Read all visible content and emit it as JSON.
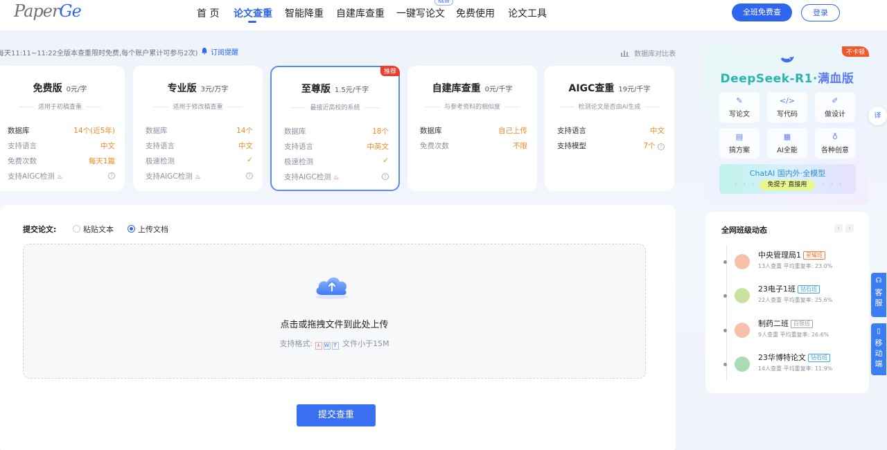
{
  "header": {
    "logo_main": "Paper",
    "logo_accent": "Ge",
    "nav": [
      "首 页",
      "论文查重",
      "智能降重",
      "自建库查重",
      "一键写论文",
      "免费使用",
      "论文工具"
    ],
    "new_badge": "NEW",
    "cta_label": "全班免费查",
    "login_label": "登录",
    "accent_color": "#2f66f0"
  },
  "promo": {
    "text": "每天11:11~11:22全版本查重限时免费,每个账户累计可参与2次)",
    "subscribe_label": "订阅提醒",
    "compare_label": "数据库对比表"
  },
  "plans": [
    {
      "name": "免费版",
      "price": "0元/字",
      "desc": "适用于初稿查重",
      "badge": "",
      "rows": [
        {
          "k": "数据库",
          "v": "14个(近5年)",
          "type": "text"
        },
        {
          "k": "支持语言",
          "v": "中文",
          "type": "text"
        },
        {
          "k": "免费次数",
          "v": "每天1篇",
          "type": "text"
        },
        {
          "k": "支持AIGC检测",
          "v": "",
          "type": "help"
        }
      ]
    },
    {
      "name": "专业版",
      "price": "3元/万字",
      "desc": "适用于修改稿查重",
      "badge": "",
      "rows": [
        {
          "k": "数据库",
          "v": "14个",
          "type": "text"
        },
        {
          "k": "支持语言",
          "v": "中文",
          "type": "text"
        },
        {
          "k": "极速检测",
          "v": "",
          "type": "check"
        },
        {
          "k": "支持AIGC检测",
          "v": "",
          "type": "help"
        }
      ]
    },
    {
      "name": "至尊版",
      "price": "1.5元/千字",
      "desc": "最接近高校的系统",
      "badge": "推荐",
      "rows": [
        {
          "k": "数据库",
          "v": "18个",
          "type": "text"
        },
        {
          "k": "支持语言",
          "v": "中英文",
          "type": "text"
        },
        {
          "k": "极速检测",
          "v": "",
          "type": "check"
        },
        {
          "k": "支持AIGC检测",
          "v": "",
          "type": "help"
        }
      ]
    },
    {
      "name": "自建库查重",
      "price": "0元/千字",
      "desc": "与参考资料的相似度",
      "badge": "",
      "rows": [
        {
          "k": "数据库",
          "v": "自己上传",
          "type": "text"
        },
        {
          "k": "免费次数",
          "v": "不限",
          "type": "text"
        }
      ]
    },
    {
      "name": "AIGC查重",
      "price": "19元/千字",
      "desc": "检测论文是否由AI生成",
      "badge": "",
      "rows": [
        {
          "k": "支持语言",
          "v": "中文",
          "type": "text"
        },
        {
          "k": "支持模型",
          "v": "7个",
          "type": "help-val"
        }
      ]
    }
  ],
  "upload": {
    "submit_label": "提交论文:",
    "radio_paste": "粘贴文本",
    "radio_upload": "上传文档",
    "selected": "upload",
    "drop_text": "点击或拖拽文件到此处上传",
    "format_prefix": "支持格式:",
    "format_suffix": "文件小于15M",
    "button_label": "提交查重"
  },
  "deepseek": {
    "badge": "不卡顿",
    "title_a": "DeepSeek-R1·",
    "title_b": "满血版",
    "tiles": [
      {
        "label": "写论文",
        "icon": "pen-icon"
      },
      {
        "label": "写代码",
        "icon": "code-icon"
      },
      {
        "label": "做设计",
        "icon": "design-icon"
      },
      {
        "label": "搞方案",
        "icon": "clipboard-icon"
      },
      {
        "label": "AI全能",
        "icon": "ai-grid-icon"
      },
      {
        "label": "各种创意",
        "icon": "bulb-icon"
      }
    ],
    "chat_title": "ChatAI 国内外·全模型",
    "chat_pill": "免提子 直接用"
  },
  "feed": {
    "title": "全网班级动态",
    "items": [
      {
        "name": "中央管理局1",
        "level": "星耀班",
        "level_color": "#f07a3a",
        "stats": "13人查重  平均重复率: 23.0%",
        "avatar_color": "#f6c1a8"
      },
      {
        "name": "23电子1班",
        "level": "钻石班",
        "level_color": "#3aa7e8",
        "stats": "22人查重  平均重复率: 25.6%",
        "avatar_color": "#c9e2a0"
      },
      {
        "name": "制药二班",
        "level": "白银班",
        "level_color": "#9aa2ad",
        "stats": "9人查重  平均重复率: 26.6%",
        "avatar_color": "#f6c1a8"
      },
      {
        "name": "23华博特论文",
        "level": "钻石班",
        "level_color": "#3aa7e8",
        "stats": "14人查重  平均重复率: 11.9%",
        "avatar_color": "#a9dcb2"
      }
    ]
  },
  "side": {
    "service_label": "客服",
    "mobile_label": "移动端"
  }
}
